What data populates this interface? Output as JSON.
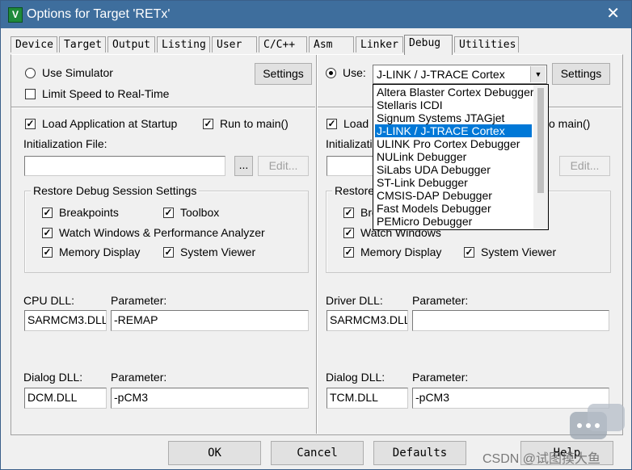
{
  "window": {
    "title": "Options for Target 'RETx'",
    "icon_glyph": "V",
    "close_glyph": "✕"
  },
  "tabs": [
    {
      "label": "Device"
    },
    {
      "label": "Target"
    },
    {
      "label": "Output"
    },
    {
      "label": "Listing"
    },
    {
      "label": "User"
    },
    {
      "label": "C/C++"
    },
    {
      "label": "Asm"
    },
    {
      "label": "Linker"
    },
    {
      "label": "Debug"
    },
    {
      "label": "Utilities"
    }
  ],
  "active_tab": "Debug",
  "left": {
    "use_simulator": {
      "label": "Use Simulator",
      "checked": false
    },
    "settings_label": "Settings",
    "limit_speed": {
      "label": "Limit Speed to Real-Time",
      "checked": false
    },
    "load_app": {
      "label": "Load Application at Startup",
      "checked": true
    },
    "run_to_main": {
      "label": "Run to main()",
      "checked": true
    },
    "init_file_label": "Initialization File:",
    "init_file_value": "",
    "browse_label": "...",
    "edit_label": "Edit...",
    "restore_group": {
      "title": "Restore Debug Session Settings",
      "breakpoints": {
        "label": "Breakpoints",
        "checked": true
      },
      "toolbox": {
        "label": "Toolbox",
        "checked": true
      },
      "watch": {
        "label": "Watch Windows & Performance Analyzer",
        "checked": true
      },
      "memory": {
        "label": "Memory Display",
        "checked": true
      },
      "sysviewer": {
        "label": "System Viewer",
        "checked": true
      }
    },
    "cpu_dll_label": "CPU DLL:",
    "cpu_dll_value": "SARMCM3.DLL",
    "cpu_param_label": "Parameter:",
    "cpu_param_value": "-REMAP",
    "dialog_dll_label": "Dialog DLL:",
    "dialog_dll_value": "DCM.DLL",
    "dialog_param_label": "Parameter:",
    "dialog_param_value": "-pCM3"
  },
  "right": {
    "use": {
      "label": "Use:",
      "checked": true
    },
    "debugger_selected": "J-LINK / J-TRACE Cortex",
    "settings_label": "Settings",
    "load_label": "Load",
    "run_to_main_fragment": "o main()",
    "init_label": "Initializatio",
    "edit_label": "Edit...",
    "restore_fragment": "Restore",
    "bre_fragment": "Bre",
    "watch_label": "Watch Windows",
    "memory_label": "Memory Display",
    "sysviewer_label": "System Viewer",
    "driver_dll_label": "Driver DLL:",
    "driver_dll_value": "SARMCM3.DLL",
    "driver_param_label": "Parameter:",
    "driver_param_value": "",
    "dialog_dll_label": "Dialog DLL:",
    "dialog_dll_value": "TCM.DLL",
    "dialog_param_label": "Parameter:",
    "dialog_param_value": "-pCM3"
  },
  "dropdown_options": [
    "Altera Blaster Cortex Debugger",
    "Stellaris ICDI",
    "Signum Systems JTAGjet",
    "J-LINK / J-TRACE Cortex",
    "ULINK Pro Cortex Debugger",
    "NULink Debugger",
    "SiLabs UDA Debugger",
    "ST-Link Debugger",
    "CMSIS-DAP Debugger",
    "Fast Models Debugger",
    "PEMicro Debugger"
  ],
  "dropdown_selected_index": 3,
  "buttons": {
    "ok": "OK",
    "cancel": "Cancel",
    "defaults": "Defaults",
    "help": "Help"
  },
  "watermark": "CSDN @试图摸大鱼",
  "colors": {
    "titlebar": "#3e6e9d",
    "selection": "#0078d7"
  }
}
